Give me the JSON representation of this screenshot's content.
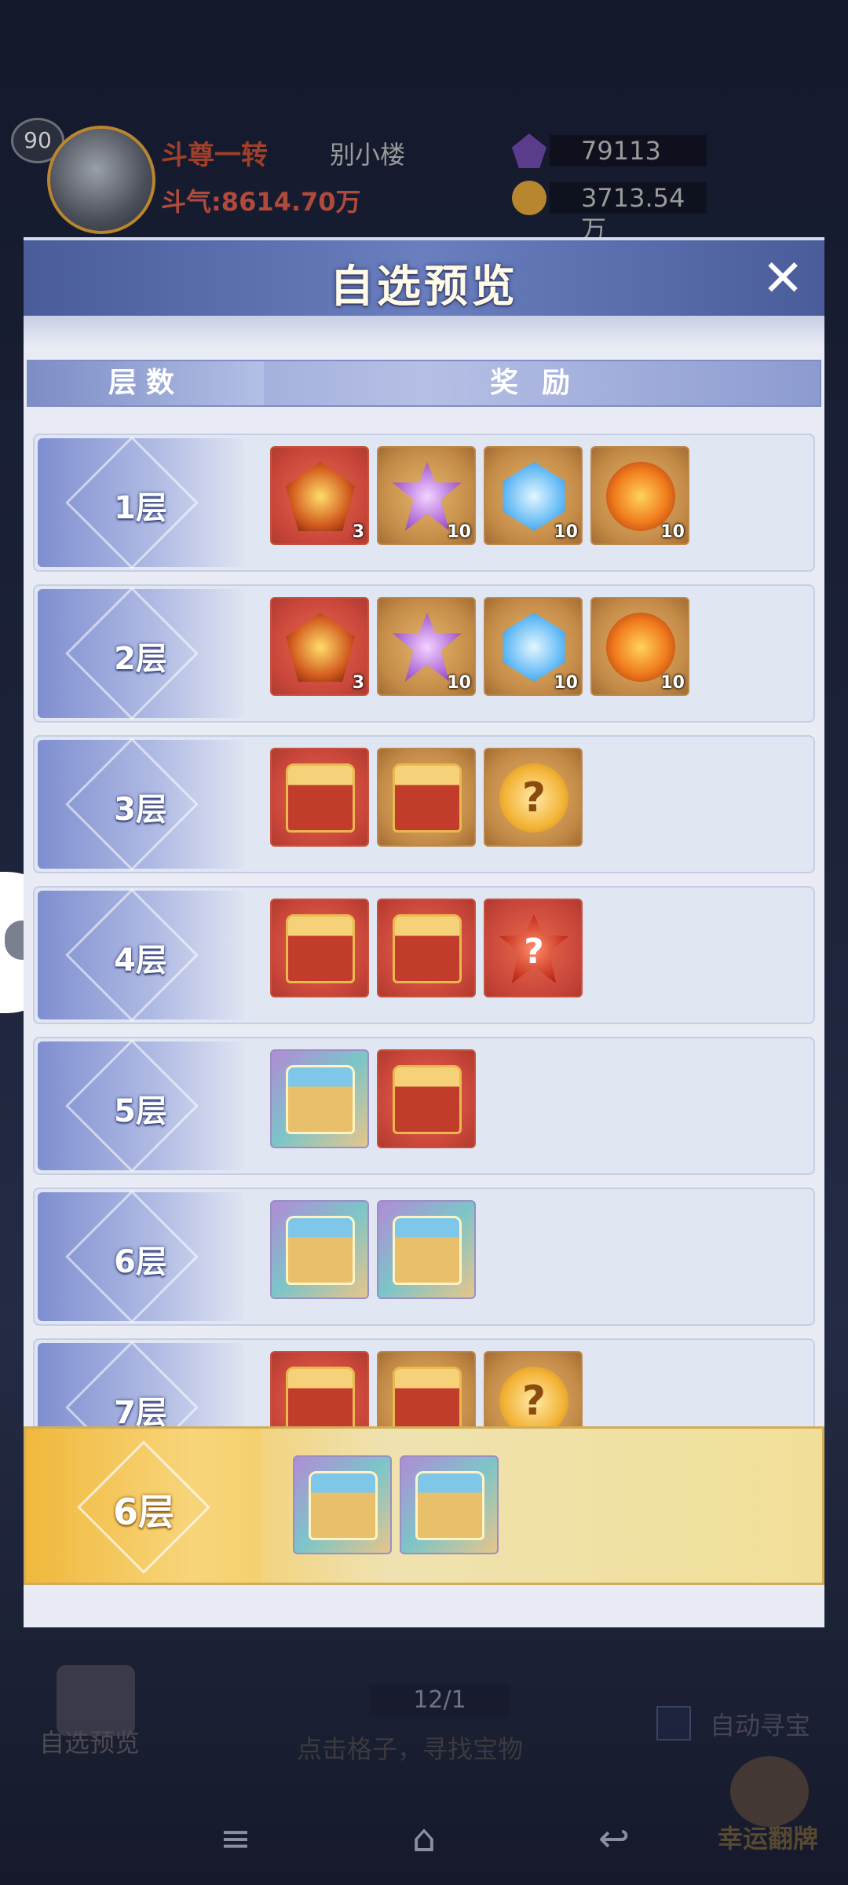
{
  "header": {
    "level": "90",
    "rank_title": "斗尊一转",
    "player_name": "别小楼",
    "power": "斗气:8614.70万",
    "resource_1": "79113",
    "resource_2": "3713.54万"
  },
  "modal": {
    "title": "自选预览",
    "close_icon": "close-icon",
    "col_floor": "层数",
    "col_reward": "奖励",
    "rows": [
      {
        "label": "1层",
        "items": [
          {
            "icon": "demon-crest",
            "bg": "red",
            "qty": "3"
          },
          {
            "icon": "lotus",
            "bg": "gold",
            "qty": "10"
          },
          {
            "icon": "blue-crystal",
            "bg": "gold",
            "qty": "10"
          },
          {
            "icon": "fire-orb",
            "bg": "gold",
            "qty": "10"
          }
        ]
      },
      {
        "label": "2层",
        "items": [
          {
            "icon": "demon-crest",
            "bg": "red",
            "qty": "3"
          },
          {
            "icon": "lotus",
            "bg": "gold",
            "qty": "10"
          },
          {
            "icon": "blue-crystal",
            "bg": "gold",
            "qty": "10"
          },
          {
            "icon": "fire-orb",
            "bg": "gold",
            "qty": "10"
          }
        ]
      },
      {
        "label": "3层",
        "items": [
          {
            "icon": "red-chest",
            "bg": "red",
            "qty": ""
          },
          {
            "icon": "gold-chest",
            "bg": "gold",
            "qty": ""
          },
          {
            "icon": "mystery-orb",
            "bg": "gold",
            "qty": ""
          }
        ]
      },
      {
        "label": "4层",
        "items": [
          {
            "icon": "s-plus-chest",
            "bg": "red",
            "qty": ""
          },
          {
            "icon": "red-chest",
            "bg": "red",
            "qty": ""
          },
          {
            "icon": "mystery-star",
            "bg": "red",
            "qty": ""
          }
        ]
      },
      {
        "label": "5层",
        "items": [
          {
            "icon": "rainbow-chest",
            "bg": "rainbow",
            "qty": ""
          },
          {
            "icon": "red-chest",
            "bg": "red",
            "qty": ""
          }
        ]
      },
      {
        "label": "6层",
        "items": [
          {
            "icon": "rainbow-chest",
            "bg": "rainbow",
            "qty": ""
          },
          {
            "icon": "rainbow-chest",
            "bg": "rainbow",
            "qty": ""
          }
        ]
      },
      {
        "label": "7层",
        "items": [
          {
            "icon": "red-chest",
            "bg": "red",
            "qty": ""
          },
          {
            "icon": "gold-chest",
            "bg": "gold",
            "qty": ""
          },
          {
            "icon": "mystery-orb",
            "bg": "gold",
            "qty": ""
          }
        ]
      }
    ],
    "selected": {
      "label": "6层",
      "items": [
        {
          "icon": "rainbow-chest",
          "bg": "rainbow",
          "qty": ""
        },
        {
          "icon": "rainbow-chest",
          "bg": "rainbow",
          "qty": ""
        }
      ]
    }
  },
  "bottom": {
    "preview_label": "自选预览",
    "progress": "12/1",
    "hint": "点击格子，寻找宝物",
    "auto_label": "自动寻宝",
    "lucky_label": "幸运翻牌"
  },
  "nav": {
    "menu": "≡",
    "home": "⌂",
    "back": "↩"
  }
}
